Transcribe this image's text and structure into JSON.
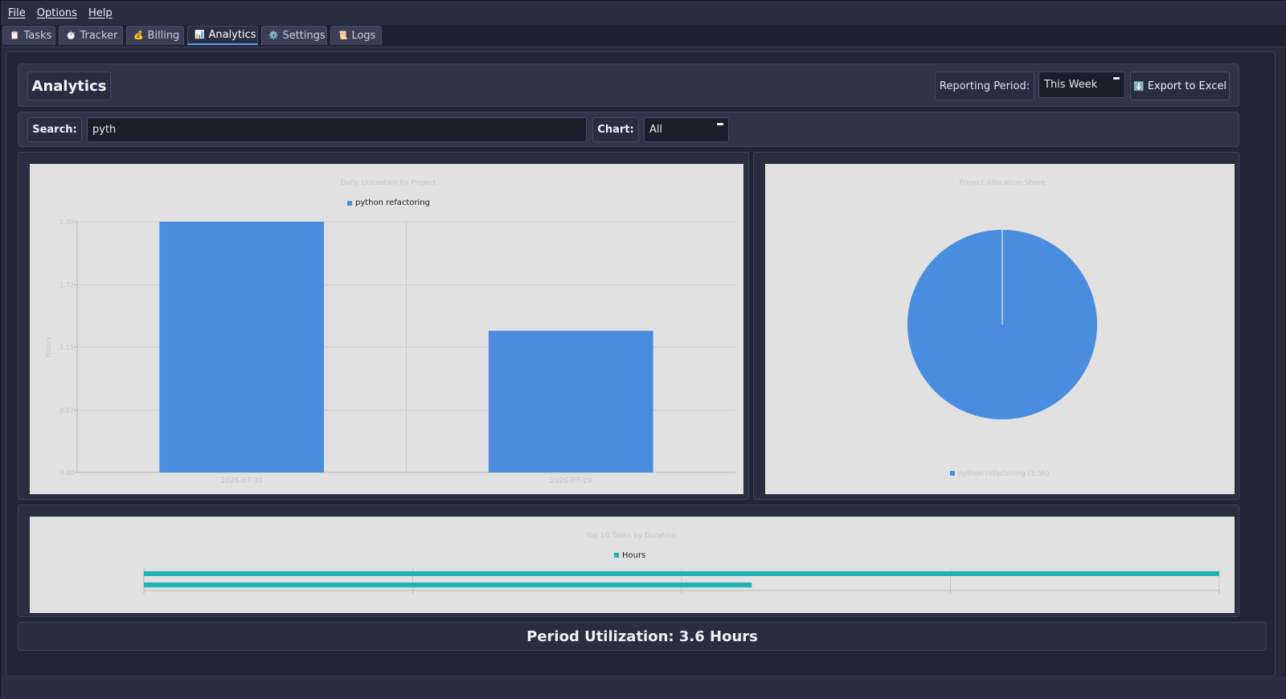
{
  "menu": {
    "items": [
      "File",
      "Options",
      "Help"
    ]
  },
  "tabs": [
    {
      "icon": "clipboard-icon",
      "glyph": "📋",
      "label": "Tasks"
    },
    {
      "icon": "stopwatch-icon",
      "glyph": "⏱️",
      "label": "Tracker"
    },
    {
      "icon": "money-bag-icon",
      "glyph": "💰",
      "label": "Billing"
    },
    {
      "icon": "bar-chart-icon",
      "glyph": "📊",
      "label": "Analytics",
      "active": true
    },
    {
      "icon": "gear-icon",
      "glyph": "⚙️",
      "label": "Settings"
    },
    {
      "icon": "scroll-icon",
      "glyph": "📜",
      "label": "Logs"
    }
  ],
  "header": {
    "title": "Analytics",
    "period_label": "Reporting Period:",
    "period_value": "This Week",
    "export_glyph": "⬇️",
    "export_label": "Export to Excel"
  },
  "filter": {
    "search_label": "Search:",
    "search_value": "pyth",
    "chart_label": "Chart:",
    "chart_value": "All"
  },
  "footer": {
    "utilization": "Period Utilization: 3.6 Hours"
  },
  "colors": {
    "bar": "#4a8ddf",
    "pie": "#4a8ddf",
    "hbar": "#1eb3b3",
    "plot_bg": "#e1e1e1"
  },
  "chart_data": [
    {
      "type": "bar",
      "title": "Daily Utilization by Project",
      "ylabel": "Hours",
      "xlabel": "",
      "categories": [
        "2026-07-30",
        "2026-07-29"
      ],
      "series": [
        {
          "name": "python refactoring",
          "values": [
            2.3,
            1.3
          ]
        }
      ],
      "ylim": [
        0,
        2.3
      ],
      "yticks": [
        "0.00",
        "0.57",
        "1.15",
        "1.72",
        "2.30"
      ],
      "grid": true,
      "legend": "top"
    },
    {
      "type": "pie",
      "title": "Project Allocation Share",
      "slices": [
        {
          "label": "python refactoring (3.5h)",
          "value": 3.5
        }
      ],
      "legend": "bottom"
    },
    {
      "type": "bar",
      "orientation": "horizontal",
      "title": "Top 10 Tasks by Duration",
      "series": [
        {
          "name": "Hours",
          "values": [
            2.3,
            1.3
          ]
        }
      ],
      "xlim": [
        0,
        2.3
      ],
      "grid": true,
      "legend": "top"
    }
  ]
}
